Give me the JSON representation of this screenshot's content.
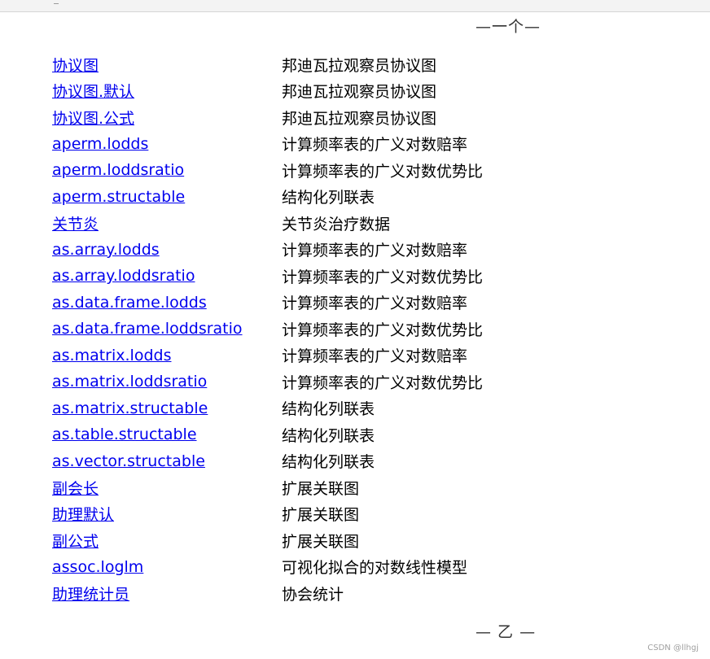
{
  "section_headers": {
    "top": "—一个—",
    "bottom": "— 乙 —"
  },
  "entries": [
    {
      "name": "协议图",
      "description": "邦迪瓦拉观察员协议图"
    },
    {
      "name": "协议图.默认",
      "description": "邦迪瓦拉观察员协议图"
    },
    {
      "name": "协议图.公式",
      "description": "邦迪瓦拉观察员协议图"
    },
    {
      "name": "aperm.lodds",
      "description": "计算频率表的广义对数赔率"
    },
    {
      "name": "aperm.loddsratio",
      "description": "计算频率表的广义对数优势比"
    },
    {
      "name": "aperm.structable",
      "description": "结构化列联表"
    },
    {
      "name": "关节炎",
      "description": "关节炎治疗数据"
    },
    {
      "name": "as.array.lodds",
      "description": "计算频率表的广义对数赔率"
    },
    {
      "name": "as.array.loddsratio",
      "description": "计算频率表的广义对数优势比"
    },
    {
      "name": "as.data.frame.lodds",
      "description": "计算频率表的广义对数赔率"
    },
    {
      "name": "as.data.frame.loddsratio",
      "description": "计算频率表的广义对数优势比"
    },
    {
      "name": "as.matrix.lodds",
      "description": "计算频率表的广义对数赔率"
    },
    {
      "name": "as.matrix.loddsratio",
      "description": "计算频率表的广义对数优势比"
    },
    {
      "name": "as.matrix.structable",
      "description": "结构化列联表"
    },
    {
      "name": "as.table.structable",
      "description": "结构化列联表"
    },
    {
      "name": "as.vector.structable",
      "description": "结构化列联表"
    },
    {
      "name": "副会长",
      "description": "扩展关联图"
    },
    {
      "name": "助理默认",
      "description": "扩展关联图"
    },
    {
      "name": "副公式",
      "description": "扩展关联图"
    },
    {
      "name": "assoc.loglm",
      "description": "可视化拟合的对数线性模型"
    },
    {
      "name": "助理统计员",
      "description": "协会统计"
    }
  ],
  "watermark": "CSDN @llhgj",
  "colors": {
    "link": "#0000ee",
    "text": "#000000",
    "header": "#333333",
    "watermark": "#a0a0a0"
  }
}
